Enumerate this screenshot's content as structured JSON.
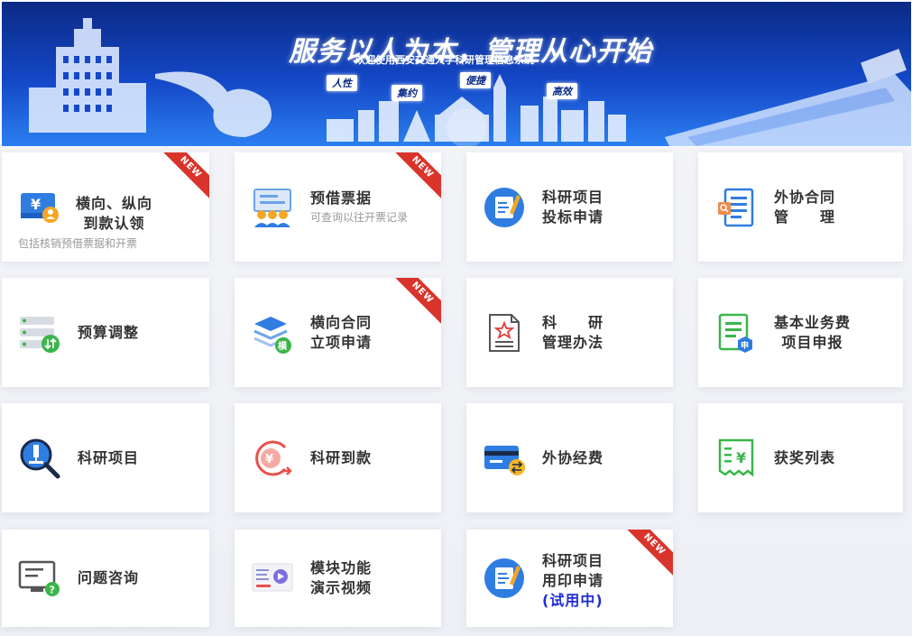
{
  "banner": {
    "slogan": "服务以人为本，管理从心开始",
    "welcome": "欢迎使用西安交通大学科研管理信息系统",
    "tags": [
      "人性",
      "集约",
      "便捷",
      "高效"
    ]
  },
  "new_badge": "NEW",
  "cards": [
    {
      "line1": "横向、纵向",
      "line2": "到款认领",
      "sub": "包括核销预借票据和开票",
      "new": true,
      "icon": "invoice-yuan-user-icon"
    },
    {
      "line1": "预借票据",
      "sub": "可查询以往开票记录",
      "new": true,
      "icon": "team-board-icon"
    },
    {
      "line1": "科研项目",
      "line2": "投标申请",
      "new": false,
      "icon": "document-pen-icon"
    },
    {
      "line1": "外协合同",
      "line2": "管　　理",
      "new": false,
      "icon": "contract-search-icon"
    },
    {
      "line1": "预算调整",
      "new": false,
      "icon": "server-exchange-icon"
    },
    {
      "line1": "横向合同",
      "line2": "立项申请",
      "new": true,
      "icon": "layers-heng-icon",
      "badge_char": "横"
    },
    {
      "line1": "科　　研",
      "line2": "管理办法",
      "new": false,
      "icon": "star-document-icon"
    },
    {
      "line1": "基本业务费",
      "line2": "项目申报",
      "new": false,
      "icon": "form-shen-icon",
      "badge_char": "申"
    },
    {
      "line1": "科研项目",
      "new": false,
      "icon": "microscope-search-icon"
    },
    {
      "line1": "科研到款",
      "new": false,
      "icon": "yuan-arrow-icon"
    },
    {
      "line1": "外协经费",
      "new": false,
      "icon": "card-transfer-icon"
    },
    {
      "line1": "获奖列表",
      "new": false,
      "icon": "yuan-receipt-icon"
    },
    {
      "line1": "问题咨询",
      "new": false,
      "icon": "monitor-question-icon"
    },
    {
      "line1": "模块功能",
      "line2": "演示视频",
      "new": false,
      "icon": "video-thumbnail-icon"
    },
    {
      "line1": "科研项目",
      "line2": "用印申请",
      "line3": "(试用中)",
      "new": true,
      "icon": "document-pen-icon"
    }
  ],
  "colors": {
    "accent": "#2f7de1",
    "ribbon": "#d9342b",
    "trial_text": "#1f2fd1",
    "title_text": "#333333",
    "sub_text": "#999999"
  }
}
